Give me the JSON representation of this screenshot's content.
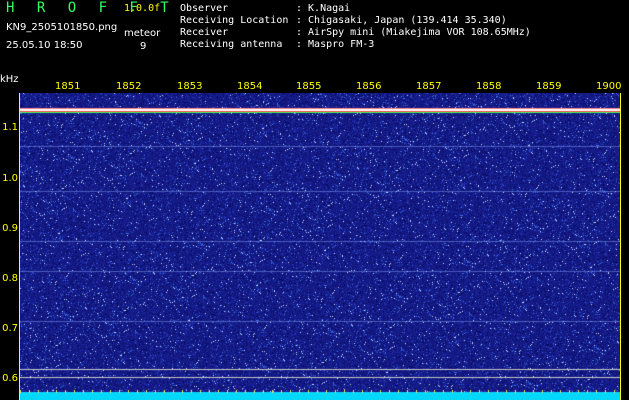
{
  "header": {
    "title": "H R O F F T",
    "version": "1.0.0f",
    "filename": "KN9_2505101850.png",
    "datetime": "25.05.10 18:50",
    "meteor_label": "meteor",
    "meteor_count": "9"
  },
  "meta": [
    {
      "label": "Observer",
      "value": ": K.Nagai"
    },
    {
      "label": "Receiving Location",
      "value": ": Chigasaki, Japan (139.414 35.340)"
    },
    {
      "label": "Receiver",
      "value": ": AirSpy mini (Miakejima VOR 108.65MHz)"
    },
    {
      "label": "Receiving antenna",
      "value": ": Maspro FM-3"
    }
  ],
  "axis": {
    "y_unit": "kHz",
    "y_ticks": [
      "1.1",
      "1.0",
      "0.9",
      "0.8",
      "0.7",
      "0.6"
    ],
    "x_ticks": [
      "1851",
      "1852",
      "1853",
      "1854",
      "1855",
      "1856",
      "1857",
      "1858",
      "1859",
      "1900"
    ]
  },
  "colors": {
    "background": "#000000",
    "axis": "#ffff00",
    "title": "#33ff66",
    "waterfall_base": "#1a1f8c",
    "carrier": "#ff4040",
    "baseline": "#00d0ff"
  }
}
